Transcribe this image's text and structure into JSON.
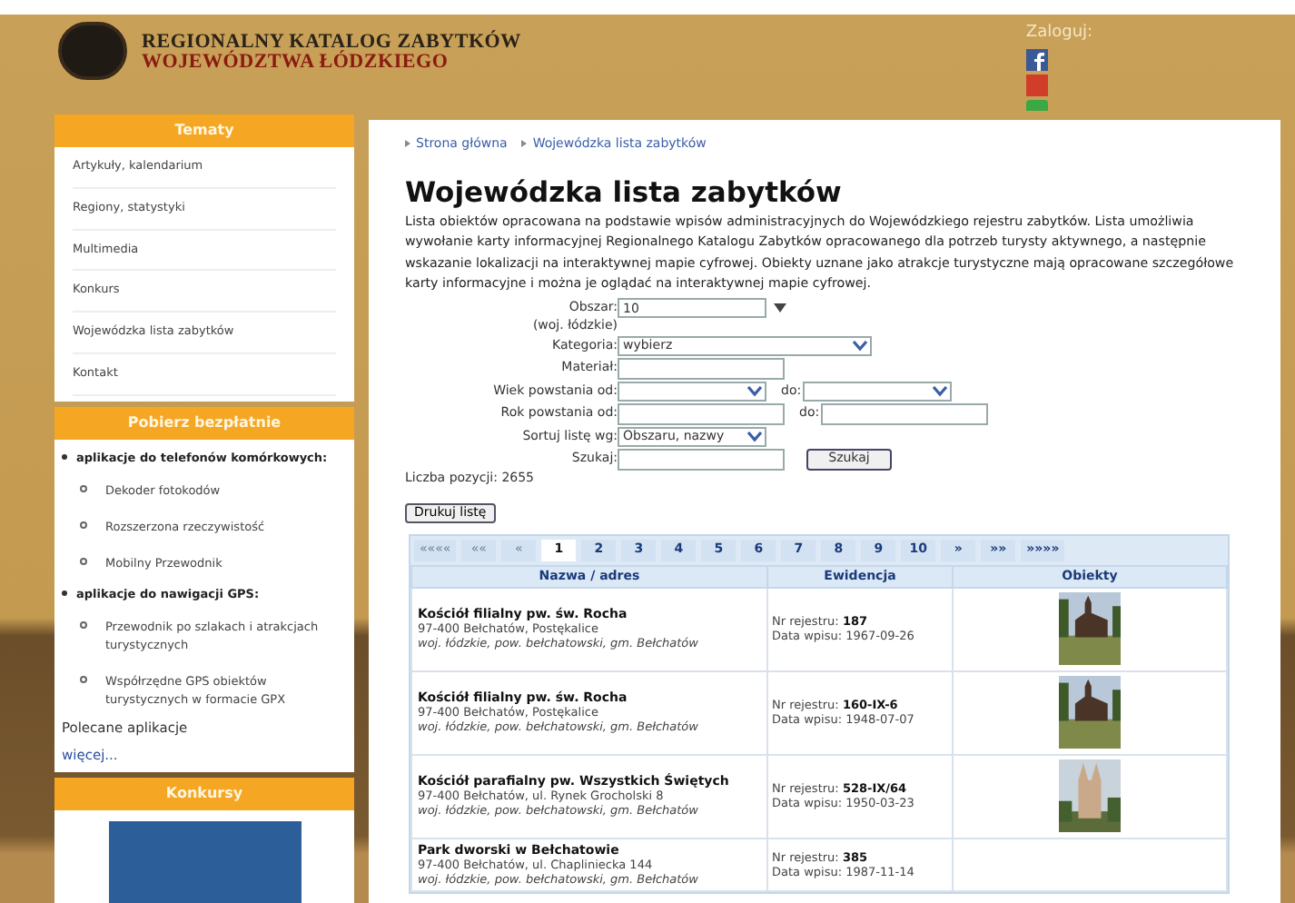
{
  "header": {
    "title_line1": "REGIONALNY KATALOG ZABYTKÓW",
    "title_line2": "WOJEWÓDZTWA ŁÓDZKIEGO",
    "login_label": "Zaloguj:"
  },
  "sidebar": [
    {
      "kind": "links",
      "title": "Tematy",
      "items": [
        "Artykuły, kalendarium",
        "Regiony, statystyki",
        "Multimedia",
        "Konkurs",
        "Wojewódzka lista zabytków",
        "Kontakt"
      ]
    },
    {
      "kind": "downloads",
      "title": "Pobierz bezpłatnie",
      "groups": [
        {
          "label": "aplikacje do telefonów komórkowych:",
          "items": [
            "Dekoder fotokodów",
            "Rozszerzona rzeczywistość",
            "Mobilny Przewodnik"
          ]
        },
        {
          "label": "aplikacje do nawigacji GPS:",
          "items": [
            "Przewodnik po szlakach i atrakcjach turystycznych",
            "Współrzędne GPS obiektów turystycznych w formacie GPX"
          ]
        }
      ],
      "extra_label": "Polecane aplikacje",
      "more_link": "więcej..."
    },
    {
      "kind": "photo",
      "title": "Konkursy"
    }
  ],
  "breadcrumb": [
    "Strona główna",
    "Wojewódzka lista zabytków"
  ],
  "heading": "Wojewódzka lista zabytków",
  "description": "Lista obiektów opracowana na podstawie wpisów administracyjnych do Wojewódzkiego rejestru zabytków. Lista umożliwia wywołanie karty informacyjnej Regionalnego Katalogu Zabytków opracowanego dla potrzeb turysty aktywnego, a następnie wskazanie lokalizacji na interaktywnej mapie cyfrowej. Obiekty uznane jako atrakcje turystyczne mają opracowane szczegółowe karty informacyjne i można je oglądać na interaktywnej mapie cyfrowej.",
  "filters": [
    {
      "label": "Obszar:",
      "sublabel": "(woj. łódzkie)",
      "kind": "combo",
      "value": "10"
    },
    {
      "label": "Kategoria:",
      "kind": "select-wide",
      "value": "wybierz"
    },
    {
      "label": "Materiał:",
      "kind": "input"
    },
    {
      "label": "Wiek powstania od:",
      "kind": "select",
      "to_label": "do:"
    },
    {
      "label": "Rok powstania od:",
      "kind": "input",
      "to_label": "do:"
    },
    {
      "label": "Sortuj listę wg:",
      "kind": "select",
      "value": "Obszaru, nazwy"
    },
    {
      "label": "Szukaj:",
      "kind": "input",
      "button": "Szukaj"
    }
  ],
  "count": "Liczba pozycji: 2655",
  "print_button": "Drukuj listę",
  "pagination": [
    {
      "label": "««««",
      "selected": false,
      "disabled": true
    },
    {
      "label": "««",
      "selected": false,
      "disabled": true
    },
    {
      "label": "«",
      "selected": false,
      "disabled": true
    },
    {
      "label": "1",
      "selected": true,
      "disabled": false
    },
    {
      "label": "2",
      "selected": false,
      "disabled": false
    },
    {
      "label": "3",
      "selected": false,
      "disabled": false
    },
    {
      "label": "4",
      "selected": false,
      "disabled": false
    },
    {
      "label": "5",
      "selected": false,
      "disabled": false
    },
    {
      "label": "6",
      "selected": false,
      "disabled": false
    },
    {
      "label": "7",
      "selected": false,
      "disabled": false
    },
    {
      "label": "8",
      "selected": false,
      "disabled": false
    },
    {
      "label": "9",
      "selected": false,
      "disabled": false
    },
    {
      "label": "10",
      "selected": false,
      "disabled": false
    },
    {
      "label": "»",
      "selected": false,
      "disabled": false
    },
    {
      "label": "»»",
      "selected": false,
      "disabled": false
    },
    {
      "label": "»»»»",
      "selected": false,
      "disabled": false
    }
  ],
  "table": {
    "columns": [
      "Nazwa / adres",
      "Ewidencja",
      "Obiekty"
    ],
    "rows": [
      {
        "name": "Kościół filialny pw. św. Rocha",
        "address": "97-400 Bełchatów, Postękalice",
        "region": "woj. łódzkie, pow. bełchatowski, gm. Bełchatów",
        "reg_label": "Nr rejestru:",
        "reg_no": "187",
        "date_label": "Data wpisu:",
        "date": "1967-09-26",
        "photo": {
          "kind": "wooden"
        }
      },
      {
        "name": "Kościół filialny pw. św. Rocha",
        "address": "97-400 Bełchatów, Postękalice",
        "region": "woj. łódzkie, pow. bełchatowski, gm. Bełchatów",
        "reg_label": "Nr rejestru:",
        "reg_no": "160-IX-6",
        "date_label": "Data wpisu:",
        "date": "1948-07-07",
        "photo": {
          "kind": "wooden"
        }
      },
      {
        "name": "Kościół parafialny pw. Wszystkich Świętych",
        "address": "97-400 Bełchatów, ul. Rynek Grocholski 8",
        "region": "woj. łódzkie, pow. bełchatowski, gm. Bełchatów",
        "reg_label": "Nr rejestru:",
        "reg_no": "528-IX/64",
        "date_label": "Data wpisu:",
        "date": "1950-03-23",
        "photo": {
          "kind": "towers"
        }
      },
      {
        "name": "Park dworski w Bełchatowie",
        "address": "97-400 Bełchatów, ul. Chapliniecka 144",
        "region": "woj. łódzkie, pow. bełchatowski, gm. Bełchatów",
        "reg_label": "Nr rejestru:",
        "reg_no": "385",
        "date_label": "Data wpisu:",
        "date": "1987-11-14"
      }
    ]
  }
}
